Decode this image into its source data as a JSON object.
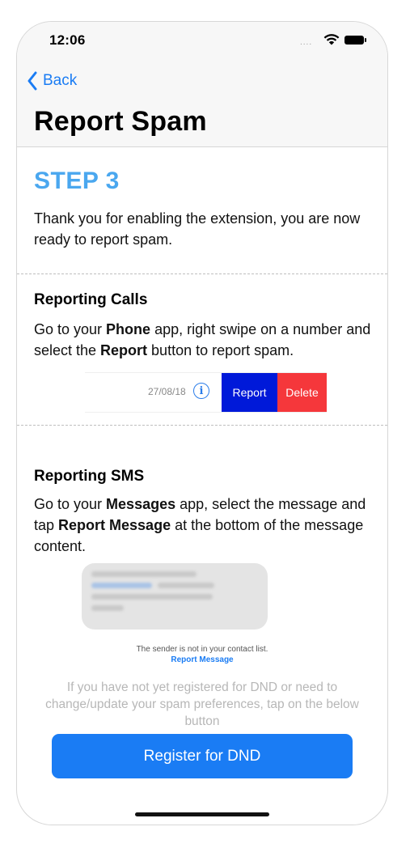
{
  "status_bar": {
    "time": "12:06",
    "signal": "....",
    "icons": [
      "wifi-icon",
      "battery-icon"
    ]
  },
  "nav": {
    "back_label": "Back",
    "title": "Report Spam"
  },
  "step": {
    "title": "STEP 3",
    "intro": "Thank you for enabling the extension, you are now ready to report spam."
  },
  "calls": {
    "heading": "Reporting Calls",
    "text_1": "Go to your ",
    "app": "Phone",
    "text_2": " app, right swipe on a  number and select the ",
    "button_name": "Report",
    "text_3": " button to report spam.",
    "demo": {
      "date": "27/08/18",
      "info_glyph": "i",
      "report_label": "Report",
      "delete_label": "Delete"
    }
  },
  "sms": {
    "heading": "Reporting SMS",
    "text_1": "Go to  your ",
    "app": "Messages",
    "text_2": " app,  select the message and tap ",
    "action": "Report Message",
    "text_3": "  at the bottom of the message content.",
    "sender_note": "The sender is not in your contact list.",
    "report_link": "Report Message"
  },
  "dnd": {
    "text": "If you have not yet registered for DND or need to change/update your spam preferences, tap on the below button",
    "button_label": "Register for DND"
  },
  "colors": {
    "accent": "#1a7cf4",
    "step": "#4aa7ef",
    "report": "#0019d9",
    "delete": "#f5373b"
  }
}
